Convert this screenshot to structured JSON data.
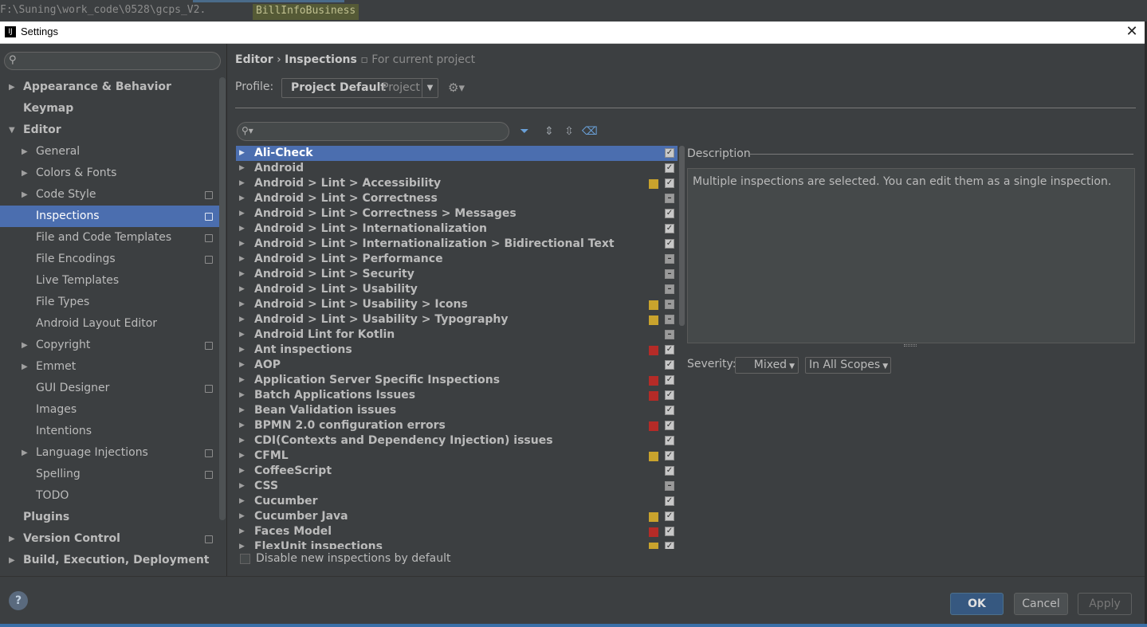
{
  "topbar": {
    "path": "F:\\Suning\\work_code\\0528\\gcps_V2.",
    "file_tab": "BillInfoBusiness"
  },
  "window": {
    "title": "Settings",
    "close_glyph": "✕",
    "app_icon": "IJ"
  },
  "sidebar": {
    "search_placeholder": "",
    "items": [
      {
        "label": "Appearance & Behavior",
        "arrow": "▶",
        "level": 0,
        "bold": true
      },
      {
        "label": "Keymap",
        "arrow": "",
        "level": 0,
        "bold": true
      },
      {
        "label": "Editor",
        "arrow": "▼",
        "level": 0,
        "bold": true
      },
      {
        "label": "General",
        "arrow": "▶",
        "level": 1
      },
      {
        "label": "Colors & Fonts",
        "arrow": "▶",
        "level": 1
      },
      {
        "label": "Code Style",
        "arrow": "▶",
        "level": 1,
        "project": true
      },
      {
        "label": "Inspections",
        "arrow": "",
        "level": 1,
        "project": true,
        "selected": true
      },
      {
        "label": "File and Code Templates",
        "arrow": "",
        "level": 1,
        "project": true
      },
      {
        "label": "File Encodings",
        "arrow": "",
        "level": 1,
        "project": true
      },
      {
        "label": "Live Templates",
        "arrow": "",
        "level": 1
      },
      {
        "label": "File Types",
        "arrow": "",
        "level": 1
      },
      {
        "label": "Android Layout Editor",
        "arrow": "",
        "level": 1
      },
      {
        "label": "Copyright",
        "arrow": "▶",
        "level": 1,
        "project": true
      },
      {
        "label": "Emmet",
        "arrow": "▶",
        "level": 1
      },
      {
        "label": "GUI Designer",
        "arrow": "",
        "level": 1,
        "project": true
      },
      {
        "label": "Images",
        "arrow": "",
        "level": 1
      },
      {
        "label": "Intentions",
        "arrow": "",
        "level": 1
      },
      {
        "label": "Language Injections",
        "arrow": "▶",
        "level": 1,
        "project": true
      },
      {
        "label": "Spelling",
        "arrow": "",
        "level": 1,
        "project": true
      },
      {
        "label": "TODO",
        "arrow": "",
        "level": 1
      },
      {
        "label": "Plugins",
        "arrow": "",
        "level": 0,
        "bold": true
      },
      {
        "label": "Version Control",
        "arrow": "▶",
        "level": 0,
        "bold": true,
        "project": true
      },
      {
        "label": "Build, Execution, Deployment",
        "arrow": "▶",
        "level": 0,
        "bold": true
      }
    ]
  },
  "breadcrumb": {
    "part1": "Editor",
    "sep": "›",
    "part2": "Inspections",
    "project_note": "For current project"
  },
  "profile": {
    "label": "Profile:",
    "name": "Project Default",
    "scope": "Project"
  },
  "colors": {
    "error": "#b52b27",
    "warning": "#c9a32d",
    "selection": "#4b6eaf"
  },
  "inspections": [
    {
      "label": "Ali-Check",
      "sev": "",
      "check": "checked",
      "selected": true
    },
    {
      "label": "Android",
      "sev": "",
      "check": "checked"
    },
    {
      "label": "Android > Lint > Accessibility",
      "sev": "warning",
      "check": "checked"
    },
    {
      "label": "Android > Lint > Correctness",
      "sev": "",
      "check": "mixed"
    },
    {
      "label": "Android > Lint > Correctness > Messages",
      "sev": "",
      "check": "checked"
    },
    {
      "label": "Android > Lint > Internationalization",
      "sev": "",
      "check": "checked"
    },
    {
      "label": "Android > Lint > Internationalization > Bidirectional Text",
      "sev": "",
      "check": "checked"
    },
    {
      "label": "Android > Lint > Performance",
      "sev": "",
      "check": "mixed"
    },
    {
      "label": "Android > Lint > Security",
      "sev": "",
      "check": "mixed"
    },
    {
      "label": "Android > Lint > Usability",
      "sev": "",
      "check": "mixed"
    },
    {
      "label": "Android > Lint > Usability > Icons",
      "sev": "warning",
      "check": "mixed"
    },
    {
      "label": "Android > Lint > Usability > Typography",
      "sev": "warning",
      "check": "mixed"
    },
    {
      "label": "Android Lint for Kotlin",
      "sev": "",
      "check": "mixed"
    },
    {
      "label": "Ant inspections",
      "sev": "error",
      "check": "checked"
    },
    {
      "label": "AOP",
      "sev": "",
      "check": "checked"
    },
    {
      "label": "Application Server Specific Inspections",
      "sev": "error",
      "check": "checked"
    },
    {
      "label": "Batch Applications Issues",
      "sev": "error",
      "check": "checked"
    },
    {
      "label": "Bean Validation issues",
      "sev": "",
      "check": "checked"
    },
    {
      "label": "BPMN 2.0 configuration errors",
      "sev": "error",
      "check": "checked"
    },
    {
      "label": "CDI(Contexts and Dependency Injection) issues",
      "sev": "",
      "check": "checked"
    },
    {
      "label": "CFML",
      "sev": "warning",
      "check": "checked"
    },
    {
      "label": "CoffeeScript",
      "sev": "",
      "check": "checked"
    },
    {
      "label": "CSS",
      "sev": "",
      "check": "mixed"
    },
    {
      "label": "Cucumber",
      "sev": "",
      "check": "checked"
    },
    {
      "label": "Cucumber Java",
      "sev": "warning",
      "check": "checked"
    },
    {
      "label": "Faces Model",
      "sev": "error",
      "check": "checked"
    },
    {
      "label": "FlexUnit inspections",
      "sev": "warning",
      "check": "checked"
    }
  ],
  "disable_new": {
    "label": "Disable new inspections by default"
  },
  "description": {
    "title": "Description",
    "text": "Multiple inspections are selected. You can edit them as a single inspection."
  },
  "severity": {
    "label": "Severity:",
    "value": "Mixed",
    "scope": "In All Scopes"
  },
  "buttons": {
    "ok": "OK",
    "cancel": "Cancel",
    "apply": "Apply",
    "help": "?"
  }
}
